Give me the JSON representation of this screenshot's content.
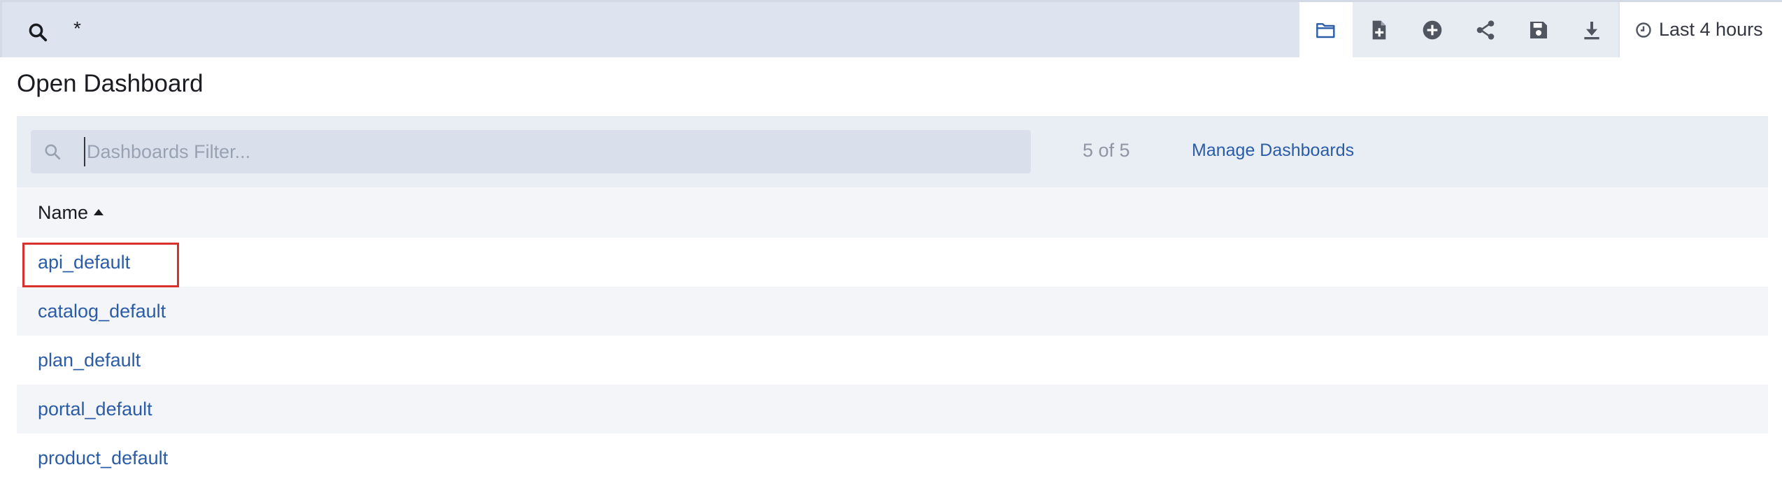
{
  "query_bar": {
    "query": "*",
    "toolbar": [
      {
        "name": "open-icon",
        "active": true
      },
      {
        "name": "new-dashboard-icon",
        "active": false
      },
      {
        "name": "add-panel-icon",
        "active": false
      },
      {
        "name": "share-icon",
        "active": false
      },
      {
        "name": "save-icon",
        "active": false
      },
      {
        "name": "download-icon",
        "active": false
      }
    ],
    "time_range": "Last 4 hours",
    "time_icon": "clock-icon"
  },
  "panel": {
    "title": "Open Dashboard",
    "filter_placeholder": "Dashboards Filter...",
    "filter_value": "",
    "count": "5 of 5",
    "manage_label": "Manage Dashboards",
    "column_header": "Name",
    "rows": [
      "api_default",
      "catalog_default",
      "plan_default",
      "portal_default",
      "product_default"
    ]
  },
  "colors": {
    "link": "#2a5ca8",
    "highlight": "#d8302a",
    "bar_bg": "#dde4ef"
  }
}
